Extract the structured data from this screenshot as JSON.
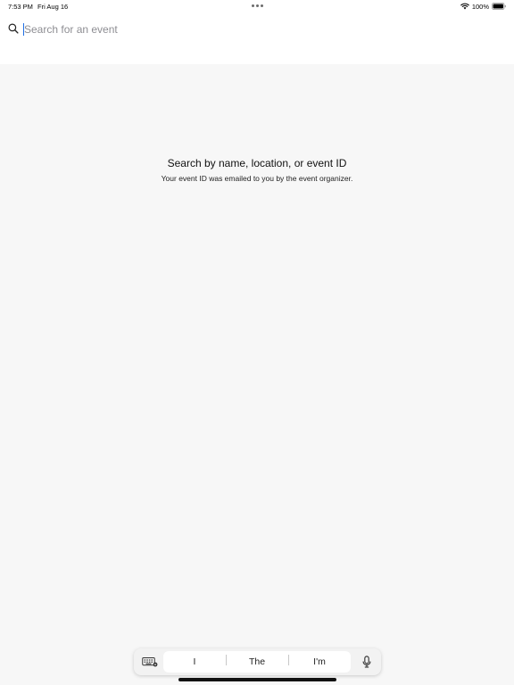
{
  "status_bar": {
    "time": "7:53 PM",
    "date": "Fri Aug 16",
    "battery": "100%",
    "icons": [
      "wifi-icon",
      "battery-icon"
    ]
  },
  "search": {
    "placeholder": "Search for an event",
    "value": "",
    "icon": "search-icon"
  },
  "empty_state": {
    "title": "Search by name, location, or event ID",
    "subtitle": "Your event ID was emailed to you by the event organizer."
  },
  "keyboard_bar": {
    "suggestions": [
      "I",
      "The",
      "I'm"
    ],
    "icons": [
      "keyboard-icon",
      "microphone-icon"
    ]
  },
  "colors": {
    "header_bg": "#ffffff",
    "page_bg": "#f7f7f7",
    "caret": "#1f6fe5",
    "placeholder": "#8e8e93"
  }
}
